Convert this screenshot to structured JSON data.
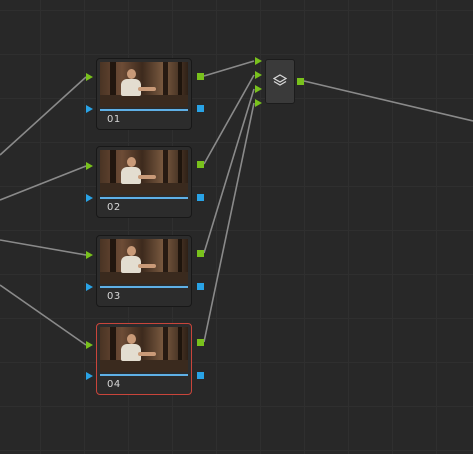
{
  "nodes": [
    {
      "label": "01",
      "selected": false
    },
    {
      "label": "02",
      "selected": false
    },
    {
      "label": "03",
      "selected": false
    },
    {
      "label": "04",
      "selected": true
    }
  ],
  "layer_mixer": {
    "icon": "layers-icon",
    "inputs": 4
  },
  "colors": {
    "background": "#282828",
    "rgb_port": "#79c11c",
    "alpha_port": "#29a3e6",
    "selected_border": "#c9453b",
    "wire": "#8a8a8a"
  }
}
